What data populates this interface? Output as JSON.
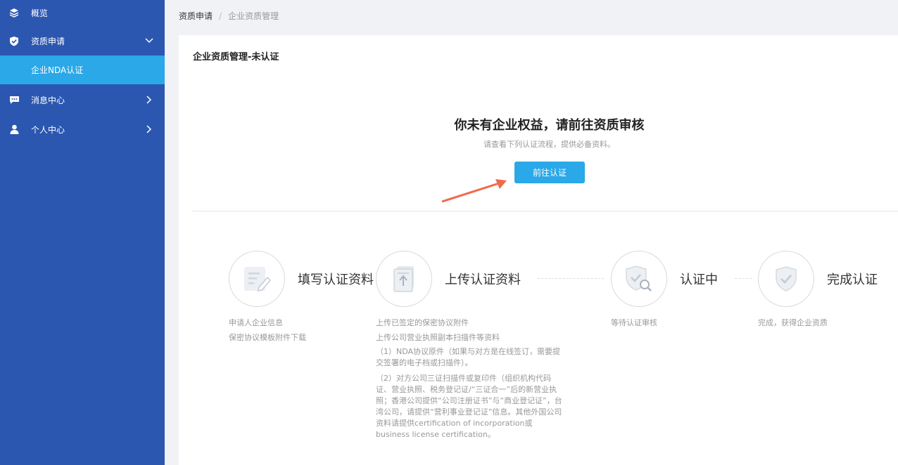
{
  "sidebar": {
    "items": [
      {
        "label": "概览",
        "icon": "layers-icon"
      },
      {
        "label": "资质申请",
        "icon": "shield-check-icon",
        "expanded": true
      },
      {
        "label": "企业NDA认证",
        "active": true
      },
      {
        "label": "消息中心",
        "icon": "message-icon"
      },
      {
        "label": "个人中心",
        "icon": "user-icon"
      }
    ]
  },
  "breadcrumb": [
    "资质申请",
    "/",
    "企业资质管理"
  ],
  "card": {
    "title": "企业资质管理-未认证",
    "hero_title": "你未有企业权益，请前往资质审核",
    "hero_sub": "请查看下列认证流程，提供必备资料。",
    "button_label": "前往认证"
  },
  "steps": [
    {
      "title": "填写认证资料",
      "icon": "edit-form-icon",
      "desc": [
        "申请人企业信息",
        "保密协议模板附件下载"
      ]
    },
    {
      "title": "上传认证资料",
      "icon": "upload-doc-icon",
      "desc": [
        "上传已签定的保密协议附件",
        "上传公司营业执照副本扫描件等资料"
      ],
      "detail": [
        "（1）NDA协议原件（如果与对方是在线签订，需要提交签署的电子档或扫描件）。",
        "（2）对方公司三证扫描件或复印件（组织机构代码证、营业执照、税务登记证/“三证合一”后的新营业执照；香港公司提供“公司注册证书”与“商业登记证”，台湾公司，请提供“营利事业登记证”信息。其他外国公司资料请提供certification of incorporation或business license certification。"
      ]
    },
    {
      "title": "认证中",
      "icon": "shield-search-icon",
      "desc": [
        "等待认证审核"
      ]
    },
    {
      "title": "完成认证",
      "icon": "shield-check-icon",
      "desc": [
        "完成，获得企业资质"
      ]
    }
  ],
  "colors": {
    "sidebar": "#2b57b0",
    "accent": "#2aa8e8",
    "arrow": "#f06a4a"
  }
}
